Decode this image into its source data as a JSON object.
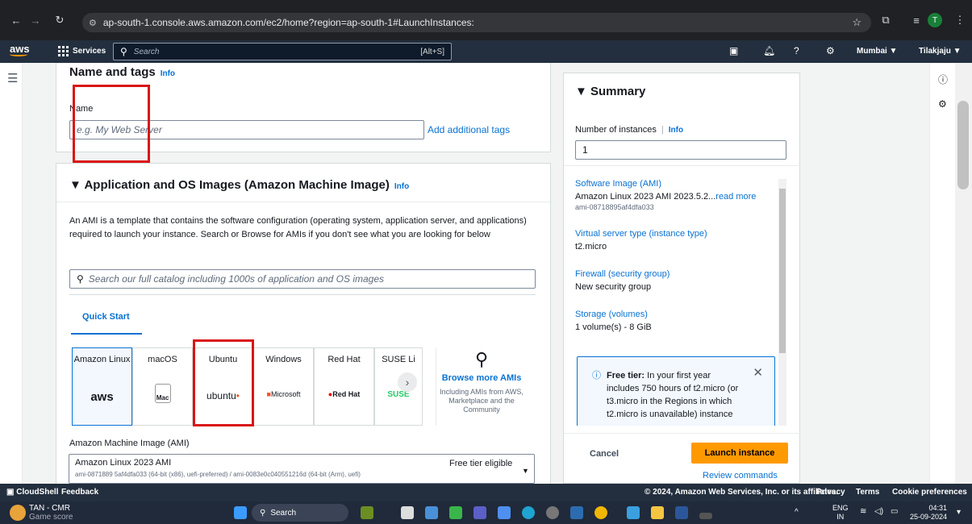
{
  "browser": {
    "url": "ap-south-1.console.aws.amazon.com/ec2/home?region=ap-south-1#LaunchInstances:",
    "profile_initial": "T"
  },
  "aws_nav": {
    "logo": "aws",
    "services": "Services",
    "search_placeholder": "Search",
    "shortcut": "[Alt+S]",
    "region": "Mumbai ▼",
    "user": "Tilakjaju ▼"
  },
  "name_tags": {
    "title": "Name and tags",
    "info": "Info",
    "name_label": "Name",
    "name_placeholder": "e.g. My Web Server",
    "add_tags": "Add additional tags"
  },
  "ami": {
    "title": "Application and OS Images (Amazon Machine Image)",
    "info": "Info",
    "description": "An AMI is a template that contains the software configuration (operating system, application server, and applications) required to launch your instance. Search or Browse for AMIs if you don't see what you are looking for below",
    "search_placeholder": "Search our full catalog including 1000s of application and OS images",
    "quick_start": "Quick Start",
    "os_tiles": [
      {
        "name": "Amazon Linux",
        "logo": "aws"
      },
      {
        "name": "macOS",
        "logo": "Mac"
      },
      {
        "name": "Ubuntu",
        "logo": "ubuntu"
      },
      {
        "name": "Windows",
        "logo": "Microsoft"
      },
      {
        "name": "Red Hat",
        "logo": "Red Hat"
      },
      {
        "name": "SUSE Li",
        "logo": "SUSE"
      }
    ],
    "browse_more": "Browse more AMIs",
    "browse_desc": "Including AMIs from AWS, Marketplace and the Community",
    "ami_label": "Amazon Machine Image (AMI)",
    "ami_selected": "Amazon Linux 2023 AMI",
    "ami_detail": "ami-0871889 5af4dfa033 (64-bit (x86), uefi-preferred) / ami-0083e0c040551216d (64-bit (Arm), uefi)",
    "free_tier_eligible": "Free tier eligible"
  },
  "summary": {
    "title": "Summary",
    "instances_label": "Number of instances",
    "info": "Info",
    "instances_value": "1",
    "software_label": "Software Image (AMI)",
    "software_value": "Amazon Linux 2023 AMI 2023.5.2...",
    "read_more": "read more",
    "software_id": "ami-08718895af4dfa033",
    "type_label": "Virtual server type (instance type)",
    "type_value": "t2.micro",
    "firewall_label": "Firewall (security group)",
    "firewall_value": "New security group",
    "storage_label": "Storage (volumes)",
    "storage_value": "1 volume(s) - 8 GiB",
    "free_tier_bold": "Free tier:",
    "free_tier_text": "In your first year includes 750 hours of t2.micro (or t3.micro in the Regions in which t2.micro is unavailable) instance",
    "cancel": "Cancel",
    "launch": "Launch instance",
    "review": "Review commands"
  },
  "footer": {
    "cloudshell": "CloudShell",
    "feedback": "Feedback",
    "copyright": "© 2024, Amazon Web Services, Inc. or its affiliates.",
    "privacy": "Privacy",
    "terms": "Terms",
    "cookies": "Cookie preferences"
  },
  "taskbar": {
    "app_title": "TAN - CMR",
    "app_sub": "Game score",
    "search": "Search",
    "lang": "ENG",
    "lang_sub": "IN",
    "time": "04:31",
    "date": "25-09-2024"
  }
}
